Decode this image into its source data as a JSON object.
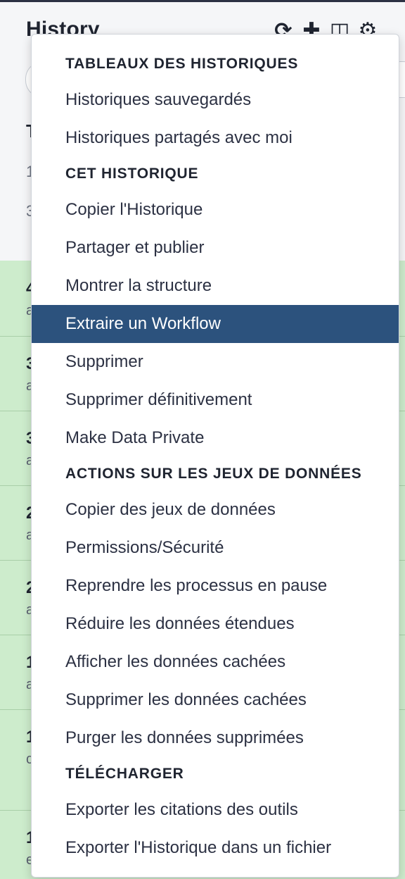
{
  "panel": {
    "title": "History",
    "icons": [
      "refresh-icon",
      "plus-icon",
      "columns-icon",
      "gear-icon"
    ]
  },
  "background_rows": [
    {
      "hid": "4",
      "meta": "a"
    },
    {
      "hid": "3",
      "meta": "a"
    },
    {
      "hid": "3",
      "meta": "a"
    },
    {
      "hid": "2",
      "meta": "a"
    },
    {
      "hid": "2",
      "meta": "a"
    },
    {
      "hid": "1",
      "meta": "a"
    },
    {
      "hid": "1",
      "meta": "c"
    },
    {
      "hid": "1",
      "meta": "e"
    }
  ],
  "background_header_text": {
    "line1": "T",
    "line2": "1",
    "line3": "3"
  },
  "menu": {
    "section1_header": "TABLEAUX DES HISTORIQUES",
    "saved_histories": "Historiques sauvegardés",
    "shared_histories": "Historiques partagés avec moi",
    "section2_header": "CET HISTORIQUE",
    "copy_history": "Copier l'Historique",
    "share_publish": "Partager et publier",
    "show_structure": "Montrer la structure",
    "extract_workflow": "Extraire un Workflow",
    "delete": "Supprimer",
    "delete_permanently": "Supprimer définitivement",
    "make_private": "Make Data Private",
    "section3_header": "ACTIONS SUR LES JEUX DE DONNÉES",
    "copy_datasets": "Copier des jeux de données",
    "permissions": "Permissions/Sécurité",
    "resume_paused": "Reprendre les processus en pause",
    "collapse_expanded": "Réduire les données étendues",
    "show_hidden": "Afficher les données cachées",
    "delete_hidden": "Supprimer les données cachées",
    "purge_deleted": "Purger les données supprimées",
    "section4_header": "TÉLÉCHARGER",
    "export_citations": "Exporter les citations des outils",
    "export_history": "Exporter l'Historique dans un fichier"
  },
  "colors": {
    "active_item_bg": "#2c527d",
    "dataset_ok_bg": "#cdeccc"
  }
}
